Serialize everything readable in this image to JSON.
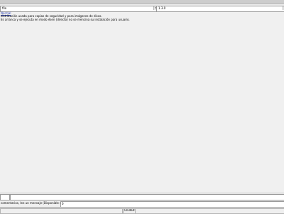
{
  "toolbar": {
    "address_value": "file",
    "version_value": "1.3.0"
  },
  "content": {
    "link_text": "Normal",
    "line1": "distribución usada para copias de seguridad y para imágenes de disco.",
    "line2": "Es arranca y se ejecuta en modo ésen (directo) no se mencina su instalación para usuario."
  },
  "bottom": {
    "hint_text": "comentarios, lee un mensaje (Disponible solo para Ubuntu):",
    "hint_field_value": "0"
  },
  "statusbar": {
    "center_label": "Unidad:"
  }
}
